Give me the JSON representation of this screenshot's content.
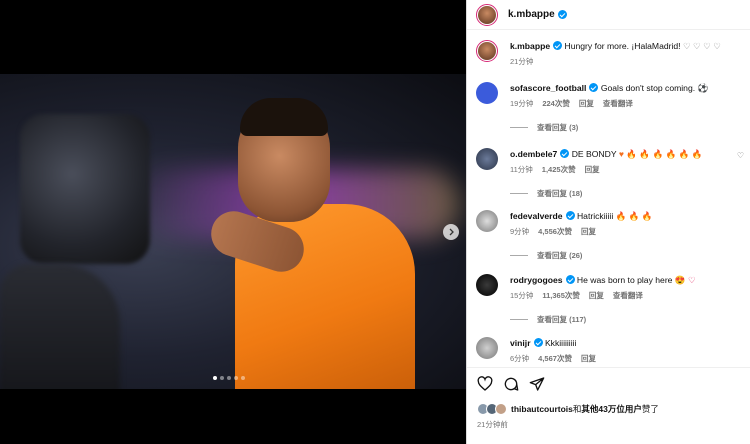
{
  "post": {
    "author": "k.mbappe",
    "caption": "Hungry for more. ¡HalaMadrid!",
    "caption_hearts": "♡ ♡ ♡ ♡",
    "caption_time": "21分钟",
    "carousel_count": 5,
    "carousel_active": 1
  },
  "comments": [
    {
      "user": "sofascore_football",
      "text": "Goals don't stop coming. ⚽",
      "time": "19分钟",
      "likes": "224次赞",
      "reply": "回复",
      "translate": "查看翻译",
      "replies": "查看回复 (3)"
    },
    {
      "user": "o.dembele7",
      "text": "DE BONDY",
      "emoji": "♥ 🔥 🔥 🔥 🔥 🔥 🔥",
      "time": "11分钟",
      "likes": "1,425次赞",
      "reply": "回复",
      "replies": "查看回复 (18)"
    },
    {
      "user": "fedevalverde",
      "text": "Hatrickiiiii",
      "emoji": "🔥 🔥 🔥",
      "time": "9分钟",
      "likes": "4,556次赞",
      "reply": "回复",
      "replies": "查看回复 (26)"
    },
    {
      "user": "rodrygogoes",
      "text": "He was born to play here",
      "emoji": "😍 ♡",
      "time": "15分钟",
      "likes": "11,365次赞",
      "reply": "回复",
      "translate": "查看翻译",
      "replies": "查看回复 (117)"
    },
    {
      "user": "vinijr",
      "text": "Kkkiiiiiiiii",
      "time": "6分钟",
      "likes": "4,567次赞",
      "reply": "回复"
    }
  ],
  "likes": {
    "lead_user": "thibautcourtois",
    "joiner": "和",
    "others": "其他43万位用户",
    "suffix": "赞了"
  },
  "post_time": "21分钟前",
  "colors": {
    "verified": "#0095f6",
    "jersey": "#f07a12",
    "ring": "#d62976"
  },
  "icons": [
    "heart-icon",
    "comment-icon",
    "share-icon",
    "chevron-right-icon"
  ]
}
